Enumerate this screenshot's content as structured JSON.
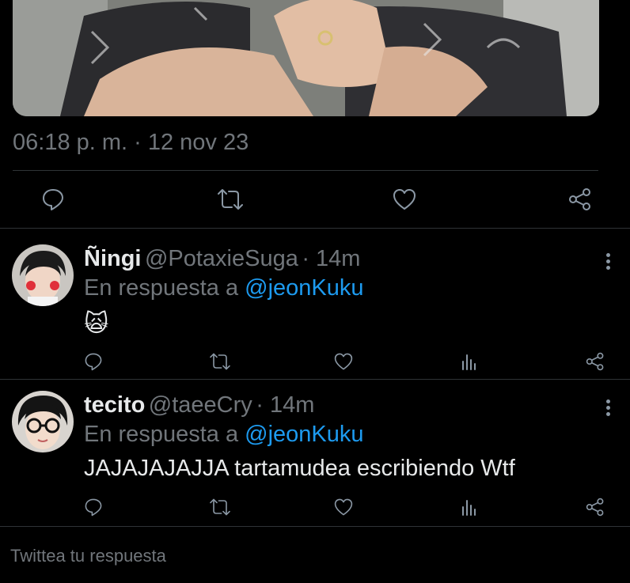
{
  "tweet": {
    "timestamp": "06:18 p. m. · 12 nov 23"
  },
  "replies": [
    {
      "name": "Ñingi",
      "handle": "@PotaxieSuga",
      "time": "· 14m",
      "reply_prefix": "En respuesta a",
      "reply_to": "@jeonKuku",
      "text": "🙀"
    },
    {
      "name": "tecito",
      "handle": "@taeeCry",
      "time": "· 14m",
      "reply_prefix": "En respuesta a",
      "reply_to": "@jeonKuku",
      "text": "JAJAJAJAJJA tartamudea escribiendo Wtf"
    }
  ],
  "compose": {
    "placeholder": "Twittea tu respuesta"
  },
  "colors": {
    "background": "#000000",
    "accent": "#1d9bf0",
    "muted": "#71767b",
    "icon": "#8b98a5"
  }
}
